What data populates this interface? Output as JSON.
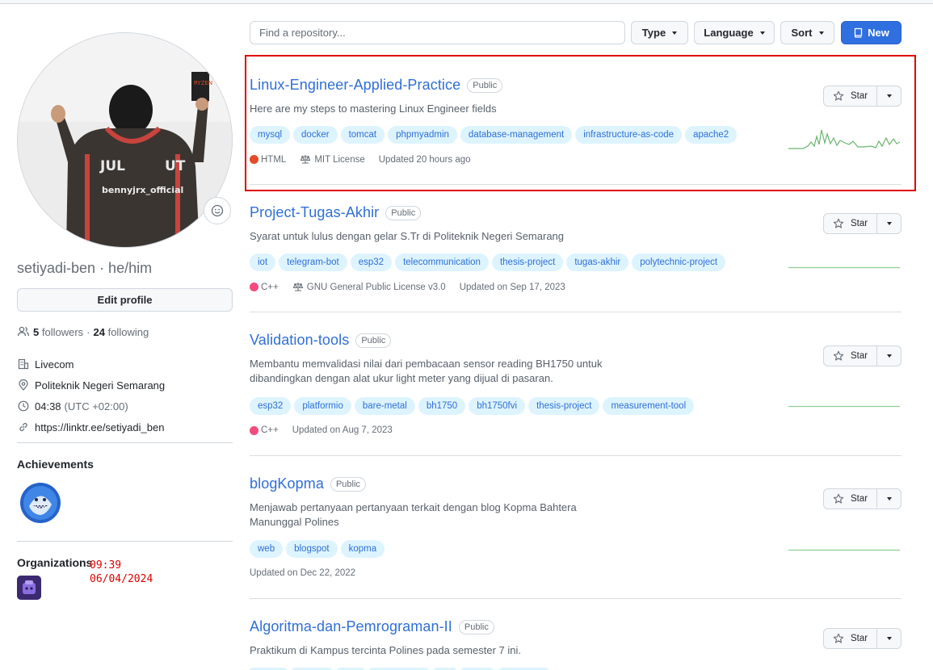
{
  "sidebar": {
    "username": "setiyadi-ben · he/him",
    "edit_profile_label": "Edit profile",
    "followers_count": "5",
    "followers_label": "followers",
    "separator": "·",
    "following_count": "24",
    "following_label": "following",
    "details": [
      {
        "icon": "organization-icon",
        "text": "Livecom",
        "extra": ""
      },
      {
        "icon": "location-icon",
        "text": "Politeknik Negeri Semarang",
        "extra": ""
      },
      {
        "icon": "clock-icon",
        "text": "04:38",
        "extra": "(UTC +02:00)"
      },
      {
        "icon": "link-icon",
        "text": "https://linktr.ee/setiyadi_ben",
        "extra": ""
      }
    ],
    "achievements_title": "Achievements",
    "organizations_title": "Organizations"
  },
  "overlay_timestamp": "09:39\n06/04/2024",
  "filters": {
    "search_placeholder": "Find a repository...",
    "type_label": "Type",
    "language_label": "Language",
    "sort_label": "Sort",
    "new_label": "New"
  },
  "star_label": "Star",
  "repos": [
    {
      "name": "Linux-Engineer-Applied-Practice",
      "visibility": "Public",
      "description": "Here are my steps to mastering Linux Engineer fields",
      "topics": [
        "mysql",
        "docker",
        "tomcat",
        "phpmyadmin",
        "database-management",
        "infrastructure-as-code",
        "apache2"
      ],
      "language": "HTML",
      "language_color": "#e34c26",
      "license": "MIT License",
      "updated": "Updated 20 hours ago"
    },
    {
      "name": "Project-Tugas-Akhir",
      "visibility": "Public",
      "description": "Syarat untuk lulus dengan gelar S.Tr di Politeknik Negeri Semarang",
      "topics": [
        "iot",
        "telegram-bot",
        "esp32",
        "telecommunication",
        "thesis-project",
        "tugas-akhir",
        "polytechnic-project"
      ],
      "language": "C++",
      "language_color": "#f34b7d",
      "license": "GNU General Public License v3.0",
      "updated": "Updated on Sep 17, 2023"
    },
    {
      "name": "Validation-tools",
      "visibility": "Public",
      "description": "Membantu memvalidasi nilai dari pembacaan sensor reading BH1750 untuk dibandingkan dengan alat ukur light meter yang dijual di pasaran.",
      "topics": [
        "esp32",
        "platformio",
        "bare-metal",
        "bh1750",
        "bh1750fvi",
        "thesis-project",
        "measurement-tool"
      ],
      "language": "C++",
      "language_color": "#f34b7d",
      "license": "",
      "updated": "Updated on Aug 7, 2023"
    },
    {
      "name": "blogKopma",
      "visibility": "Public",
      "description": "Menjawab pertanyaan pertanyaan terkait dengan blog Kopma Bahtera Manunggal Polines",
      "topics": [
        "web",
        "blogspot",
        "kopma"
      ],
      "language": "",
      "language_color": "",
      "license": "",
      "updated": "Updated on Dec 22, 2022"
    },
    {
      "name": "Algoritma-dan-Pemrograman-II",
      "visibility": "Public",
      "description": "Praktikum di Kampus tercinta Polines pada semester 7 ini.",
      "topics": [],
      "language": "",
      "language_color": "",
      "license": "",
      "updated": ""
    }
  ],
  "colors": {
    "accent": "#2f6fd6",
    "new_button": "#2f6fe0",
    "highlight_box": "#e00000",
    "sparkline": "#6ab56e"
  }
}
